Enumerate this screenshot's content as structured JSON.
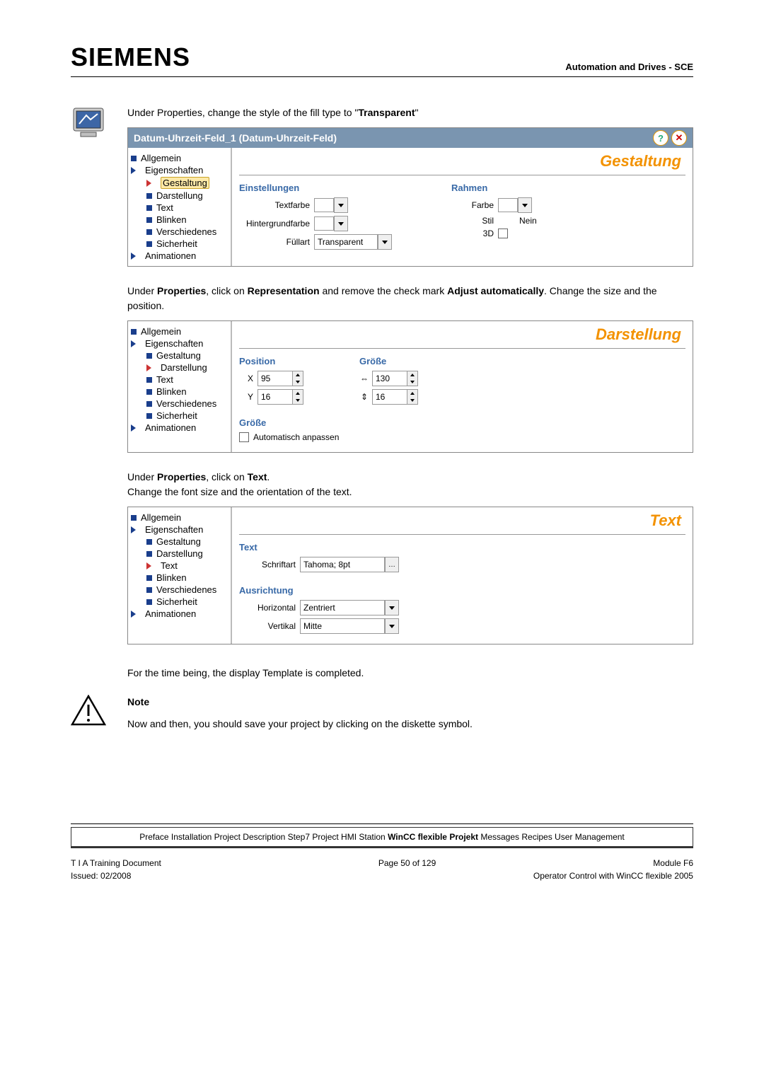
{
  "header": {
    "logo": "SIEMENS",
    "right": "Automation and Drives - SCE"
  },
  "intro1_a": "Under Properties, change the style of the fill type to \"",
  "intro1_b": "Transparent",
  "intro1_c": "\"",
  "panel1_title": "Datum-Uhrzeit-Feld_1 (Datum-Uhrzeit-Feld)",
  "tree": {
    "allgemein": "Allgemein",
    "eigenschaften": "Eigenschaften",
    "gestaltung": "Gestaltung",
    "darstellung": "Darstellung",
    "text": "Text",
    "blinken": "Blinken",
    "verschiedenes": "Verschiedenes",
    "sicherheit": "Sicherheit",
    "animationen": "Animationen"
  },
  "pane1": {
    "title": "Gestaltung",
    "einstellungen": "Einstellungen",
    "textfarbe": "Textfarbe",
    "hintergrund": "Hintergrundfarbe",
    "fuellart": "Füllart",
    "fuellart_val": "Transparent",
    "rahmen": "Rahmen",
    "farbe": "Farbe",
    "stil": "Stil",
    "stil_val": "Nein",
    "d3": "3D"
  },
  "intro2": {
    "a": "Under ",
    "b": "Properties",
    "c": ", click on ",
    "d": "Representation",
    "e": " and remove the check mark ",
    "f": "Adjust automatically",
    "g": ". Change the size and the position."
  },
  "pane2": {
    "title": "Darstellung",
    "position": "Position",
    "groesse": "Größe",
    "x": "X",
    "y": "Y",
    "x_val": "95",
    "y_val": "16",
    "w_val": "130",
    "h_val": "16",
    "groesse2": "Größe",
    "auto": "Automatisch anpassen"
  },
  "intro3": {
    "a": "Under ",
    "b": "Properties",
    "c": ", click on ",
    "d": "Text",
    "e": ".",
    "f": "Change the font size and the orientation of the text."
  },
  "pane3": {
    "title": "Text",
    "text": "Text",
    "schriftart": "Schriftart",
    "schriftart_val": "Tahoma; 8pt",
    "ausrichtung": "Ausrichtung",
    "horizontal": "Horizontal",
    "horizontal_val": "Zentriert",
    "vertikal": "Vertikal",
    "vertikal_val": "Mitte"
  },
  "closing": "For the time being, the display Template is completed.",
  "note": {
    "title": "Note",
    "body": "Now and then, you should save your project by clicking on the diskette symbol."
  },
  "footer": {
    "pre": "Preface Installation Project Description Step7 Project HMI Station ",
    "active": "WinCC flexible Projekt",
    "post": " Messages Recipes User Management",
    "l1": "T I A  Training Document",
    "c1": "Page 50 of 129",
    "r1": "Module F6",
    "l2": "Issued: 02/2008",
    "r2": "Operator Control with WinCC flexible 2005"
  }
}
